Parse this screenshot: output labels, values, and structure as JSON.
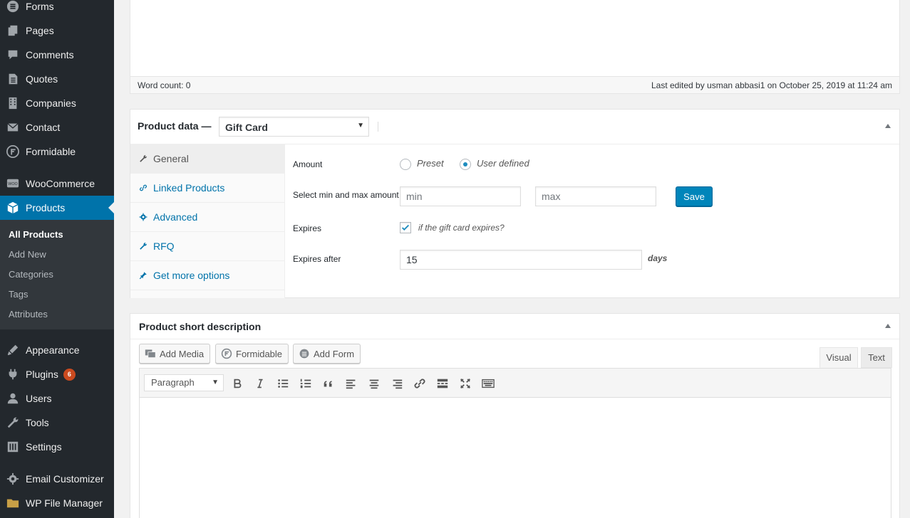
{
  "sidebar": {
    "items": [
      {
        "label": "Forms",
        "icon": "forms-icon"
      },
      {
        "label": "Pages",
        "icon": "pages-icon"
      },
      {
        "label": "Comments",
        "icon": "comments-icon"
      },
      {
        "label": "Quotes",
        "icon": "quotes-icon"
      },
      {
        "label": "Companies",
        "icon": "companies-icon"
      },
      {
        "label": "Contact",
        "icon": "contact-icon"
      },
      {
        "label": "Formidable",
        "icon": "formidable-icon"
      },
      {
        "label": "WooCommerce",
        "icon": "woocommerce-icon"
      },
      {
        "label": "Products",
        "icon": "products-icon"
      },
      {
        "label": "Appearance",
        "icon": "appearance-icon"
      },
      {
        "label": "Plugins",
        "icon": "plugins-icon",
        "badge": "6"
      },
      {
        "label": "Users",
        "icon": "users-icon"
      },
      {
        "label": "Tools",
        "icon": "tools-icon"
      },
      {
        "label": "Settings",
        "icon": "settings-icon"
      },
      {
        "label": "Email Customizer",
        "icon": "email-customizer-icon"
      },
      {
        "label": "WP File Manager",
        "icon": "file-manager-icon"
      }
    ],
    "submenu": [
      "All Products",
      "Add New",
      "Categories",
      "Tags",
      "Attributes"
    ],
    "colors": {
      "background": "#23282d",
      "active": "#0073aa",
      "submenu": "#32373c"
    }
  },
  "editor_top": {
    "word_count": "Word count: 0",
    "last_edited": "Last edited by usman abbasi1 on October 25, 2019 at 11:24 am"
  },
  "product_data": {
    "title": "Product data —",
    "type_selected": "Gift Card",
    "tabs": [
      "General",
      "Linked Products",
      "Advanced",
      "RFQ",
      "Get more options"
    ],
    "fields": {
      "amount_label": "Amount",
      "amount_options": [
        "Preset",
        "User defined"
      ],
      "amount_selected": "User defined",
      "minmax_label": "Select min and max amount",
      "min_placeholder": "min",
      "max_placeholder": "max",
      "save_label": "Save",
      "expires_label": "Expires",
      "expires_checked": true,
      "expires_text": "if the gift card expires?",
      "expires_after_label": "Expires after",
      "expires_after_value": "15",
      "days_label": "days"
    }
  },
  "short_description": {
    "title": "Product short description",
    "buttons": [
      "Add Media",
      "Formidable",
      "Add Form"
    ],
    "editor_tabs": [
      "Visual",
      "Text"
    ],
    "format_selected": "Paragraph"
  }
}
